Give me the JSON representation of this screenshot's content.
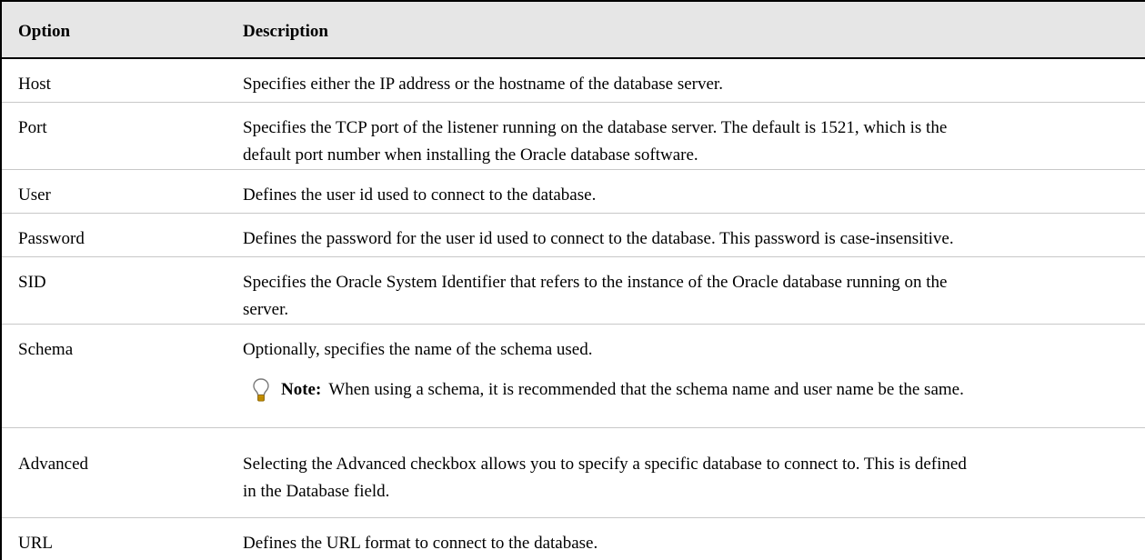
{
  "table": {
    "headers": {
      "option": "Option",
      "description": "Description"
    },
    "rows": [
      {
        "option": "Host",
        "description_lines": [
          "Specifies either the IP address or the hostname of the database server."
        ]
      },
      {
        "option": "Port",
        "description_lines": [
          "Specifies the TCP port of the listener running on the database server. The default is 1521, which is the",
          "default port number when installing the Oracle database software."
        ]
      },
      {
        "option": "User",
        "description_lines": [
          "Defines the user id used to connect to the database."
        ]
      },
      {
        "option": "Password",
        "description_lines": [
          "Defines the password for the user id used to connect to the database. This password is case-insensitive."
        ]
      },
      {
        "option": "SID",
        "description_lines": [
          "Specifies the Oracle System Identifier that refers to the instance of the Oracle database running on the",
          "server."
        ]
      },
      {
        "option": "Schema",
        "description_lines": [
          "Optionally, specifies the name of the schema used."
        ],
        "note": {
          "icon": "lightbulb-icon",
          "label": "Note:",
          "text": "When using a schema, it is recommended that the schema name and user name be the same."
        }
      },
      {
        "option": "Advanced",
        "description_lines": [
          "Selecting the Advanced checkbox allows you to specify a specific database to connect to. This is defined",
          "in the Database field."
        ]
      },
      {
        "option": "URL",
        "description_lines": [
          "Defines the URL format to connect to the database."
        ]
      }
    ]
  }
}
